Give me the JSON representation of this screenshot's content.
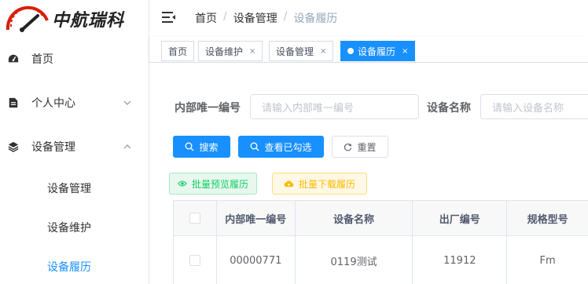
{
  "sidebar": {
    "logo_text": "中航瑞科",
    "items": [
      {
        "label": "首页",
        "icon": "dashboard-icon"
      },
      {
        "label": "个人中心",
        "icon": "document-icon"
      },
      {
        "label": "设备管理",
        "icon": "layers-icon"
      }
    ],
    "sub_items": [
      {
        "label": "设备管理",
        "active": false
      },
      {
        "label": "设备维护",
        "active": false
      },
      {
        "label": "设备履历",
        "active": true
      }
    ]
  },
  "header": {
    "breadcrumb": [
      "首页",
      "设备管理",
      "设备履历"
    ],
    "separator": "/"
  },
  "tags": [
    {
      "label": "首页",
      "closable": false,
      "active": false
    },
    {
      "label": "设备维护",
      "closable": true,
      "active": false
    },
    {
      "label": "设备管理",
      "closable": true,
      "active": false
    },
    {
      "label": "设备履历",
      "closable": true,
      "active": true
    }
  ],
  "tag_close": "×",
  "search_form": {
    "internal_id_label": "内部唯一编号",
    "internal_id_placeholder": "请输入内部唯一编号",
    "device_name_label": "设备名称",
    "device_name_placeholder": "请输入设备名称"
  },
  "buttons": {
    "search": "搜索",
    "view_checked": "查看已勾选",
    "reset": "重置",
    "batch_preview": "批量预览履历",
    "batch_download": "批量下载履历"
  },
  "table": {
    "columns": [
      "",
      "内部唯一编号",
      "设备名称",
      "出厂编号",
      "规格型号"
    ],
    "rows": [
      [
        "",
        "00000771",
        "0119测试",
        "11912",
        "Fm"
      ]
    ]
  },
  "colors": {
    "primary": "#1890ff",
    "success": "#13ce66",
    "warning": "#ffba00",
    "logo_red": "#d81e06"
  }
}
